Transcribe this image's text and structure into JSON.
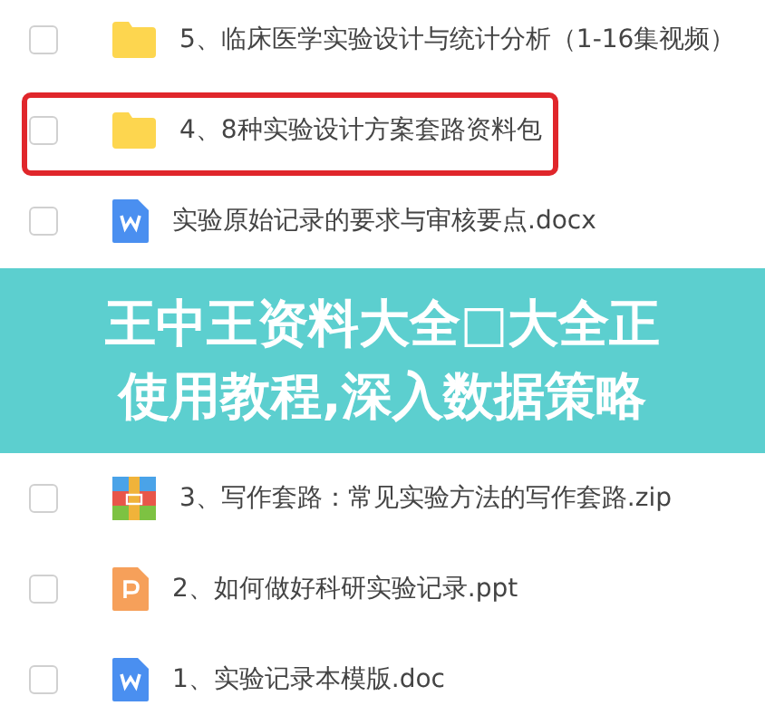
{
  "files_top": [
    {
      "name": "5、临床医学实验设计与统计分析（1-16集视频）",
      "kind": "folder",
      "checked": false,
      "highlighted": false
    },
    {
      "name": "4、8种实验设计方案套路资料包",
      "kind": "folder",
      "checked": false,
      "highlighted": true
    },
    {
      "name": "实验原始记录的要求与审核要点.docx",
      "kind": "word",
      "checked": false,
      "highlighted": false
    }
  ],
  "banner": {
    "lines": [
      "王中王资料大全□大全正",
      "使用教程,深入数据策略"
    ]
  },
  "files_bottom": [
    {
      "name": "3、写作套路：常见实验方法的写作套路.zip",
      "kind": "zip",
      "checked": false,
      "highlighted": false
    },
    {
      "name": "2、如何做好科研实验记录.ppt",
      "kind": "ppt",
      "checked": false,
      "highlighted": false
    },
    {
      "name": "1、实验记录本模版.doc",
      "kind": "word",
      "checked": false,
      "highlighted": false
    }
  ]
}
